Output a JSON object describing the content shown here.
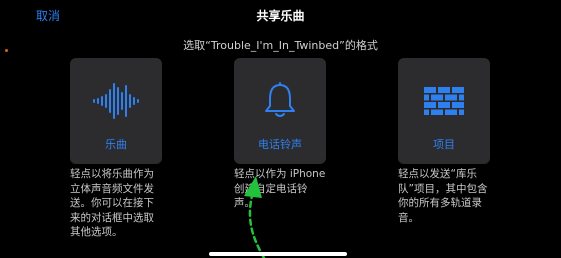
{
  "header": {
    "cancel_label": "取消",
    "title": "共享乐曲"
  },
  "subtitle": "选取“Trouble_I'm_In_Twinbed”的格式",
  "options": [
    {
      "label": "乐曲",
      "icon": "waveform-icon",
      "description": "轻点以将乐曲作为立体声音频文件发送。你可以在接下来的对话框中选取其他选项。"
    },
    {
      "label": "电话铃声",
      "icon": "bell-icon",
      "description": "轻点以作为 iPhone 创建自定电话铃声。"
    },
    {
      "label": "项目",
      "icon": "brick-icon",
      "description": "轻点以发送“库乐队”项目，其中包含你的所有多轨道录音。"
    }
  ],
  "colors": {
    "accent": "#2f80ef",
    "card_bg": "#2c2c2e",
    "annotation_arrow": "#22c23a"
  }
}
